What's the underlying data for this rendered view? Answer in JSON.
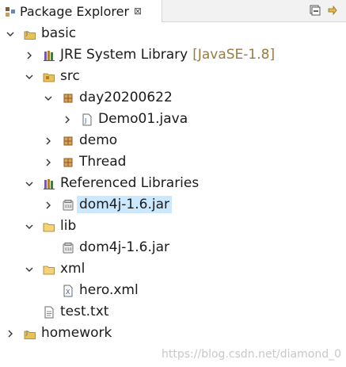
{
  "view": {
    "title": "Package Explorer",
    "close_glyph": "⊠"
  },
  "tree": [
    {
      "id": "basic",
      "label": "basic",
      "decor": "",
      "expanded": true,
      "icon": "project-icon"
    },
    {
      "id": "jre",
      "label": "JRE System Library",
      "decor": "[JavaSE-1.8]",
      "expanded": false,
      "icon": "library-icon"
    },
    {
      "id": "src",
      "label": "src",
      "decor": "",
      "expanded": true,
      "icon": "source-folder-icon"
    },
    {
      "id": "pkg-day",
      "label": "day20200622",
      "decor": "",
      "expanded": true,
      "icon": "package-icon"
    },
    {
      "id": "demo01",
      "label": "Demo01.java",
      "decor": "",
      "expanded": false,
      "icon": "java-file-icon"
    },
    {
      "id": "pkg-demo",
      "label": "demo",
      "decor": "",
      "expanded": false,
      "icon": "package-icon"
    },
    {
      "id": "pkg-thread",
      "label": "Thread",
      "decor": "",
      "expanded": false,
      "icon": "package-icon"
    },
    {
      "id": "reflibs",
      "label": "Referenced Libraries",
      "decor": "",
      "expanded": true,
      "icon": "library-icon"
    },
    {
      "id": "jar-ref",
      "label": "dom4j-1.6.jar",
      "decor": "",
      "expanded": false,
      "icon": "jar-icon",
      "selected": true
    },
    {
      "id": "lib",
      "label": "lib",
      "decor": "",
      "expanded": true,
      "icon": "folder-icon"
    },
    {
      "id": "jar-lib",
      "label": "dom4j-1.6.jar",
      "decor": "",
      "expanded": null,
      "icon": "jar-icon"
    },
    {
      "id": "xml",
      "label": "xml",
      "decor": "",
      "expanded": true,
      "icon": "folder-icon"
    },
    {
      "id": "hero",
      "label": "hero.xml",
      "decor": "",
      "expanded": null,
      "icon": "xml-file-icon"
    },
    {
      "id": "test",
      "label": "test.txt",
      "decor": "",
      "expanded": null,
      "icon": "text-file-icon"
    },
    {
      "id": "homework",
      "label": "homework",
      "decor": "",
      "expanded": false,
      "icon": "project-icon"
    }
  ],
  "watermark": "https://blog.csdn.net/diamond_0",
  "colors": {
    "selection": "#cce8ff",
    "decoration": "#9a7a43",
    "folder": "#e8c15a",
    "package": "#b77d2c"
  }
}
